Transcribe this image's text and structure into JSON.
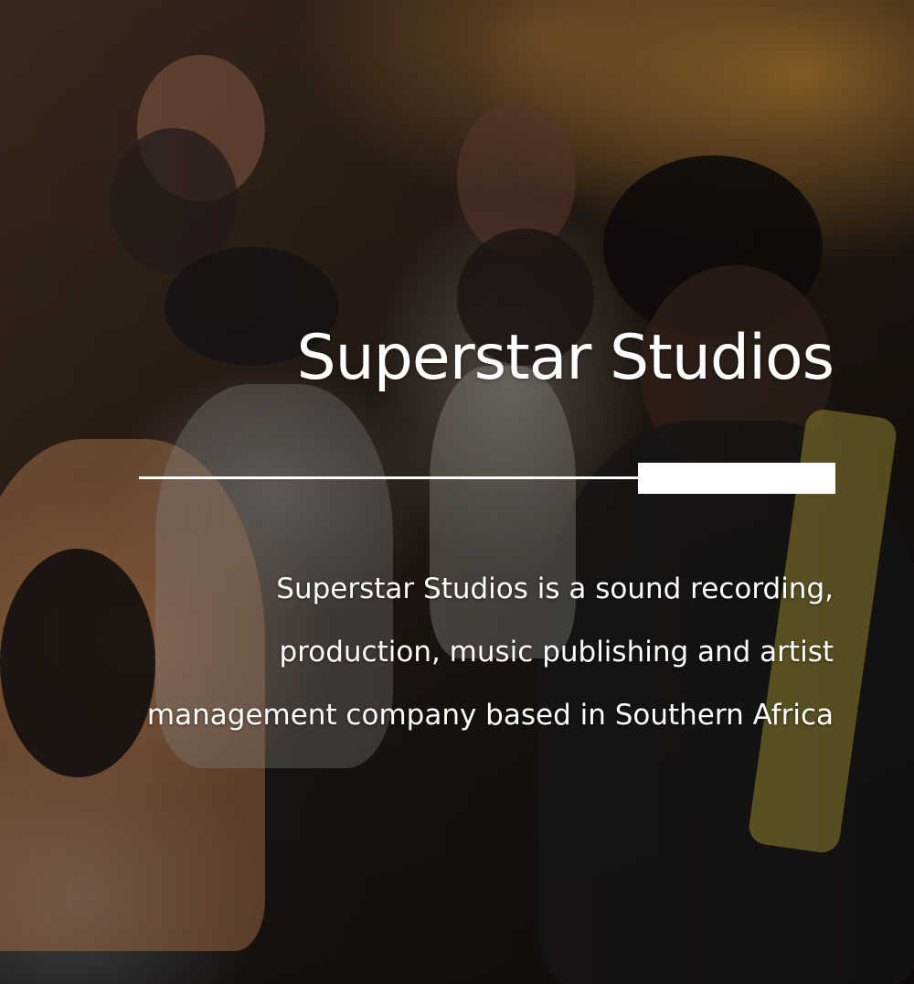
{
  "hero": {
    "title": "Superstar Studios",
    "description": "Superstar Studios is a sound recording, production, music publishing and artist management company based in Southern Africa",
    "background_photo": "crowd-concert-photo",
    "colors": {
      "text": "#ffffff",
      "divider": "#ffffff"
    }
  }
}
